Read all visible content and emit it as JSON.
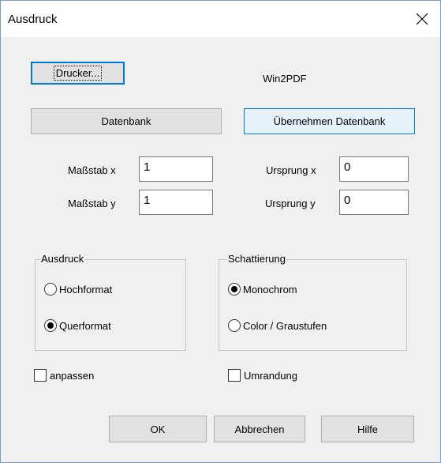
{
  "window": {
    "title": "Ausdruck",
    "close_icon": "close-icon"
  },
  "printer": {
    "button_label": "Drucker...",
    "name": "Win2PDF"
  },
  "database": {
    "button_label": "Datenbank",
    "apply_label": "Übernehmen Datenbank"
  },
  "fields": {
    "scale_x": {
      "label": "Maßstab x",
      "value": "1"
    },
    "scale_y": {
      "label": "Maßstab y",
      "value": "1"
    },
    "origin_x": {
      "label": "Ursprung x",
      "value": "0"
    },
    "origin_y": {
      "label": "Ursprung y",
      "value": "0"
    }
  },
  "orientation_group": {
    "title": "Ausdruck",
    "options": [
      {
        "label": "Hochformat",
        "selected": false
      },
      {
        "label": "Querformat",
        "selected": true
      }
    ]
  },
  "shading_group": {
    "title": "Schattierung",
    "options": [
      {
        "label": "Monochrom",
        "selected": true
      },
      {
        "label": "Color / Graustufen",
        "selected": false
      }
    ]
  },
  "checkboxes": {
    "fit": {
      "label": "anpassen",
      "checked": false
    },
    "border": {
      "label": "Umrandung",
      "checked": false
    }
  },
  "footer": {
    "ok_label": "OK",
    "cancel_label": "Abbrechen",
    "help_label": "Hilfe"
  },
  "colors": {
    "accent": "#0078d7",
    "face": "#f0f0f0",
    "button": "#e1e1e1"
  }
}
